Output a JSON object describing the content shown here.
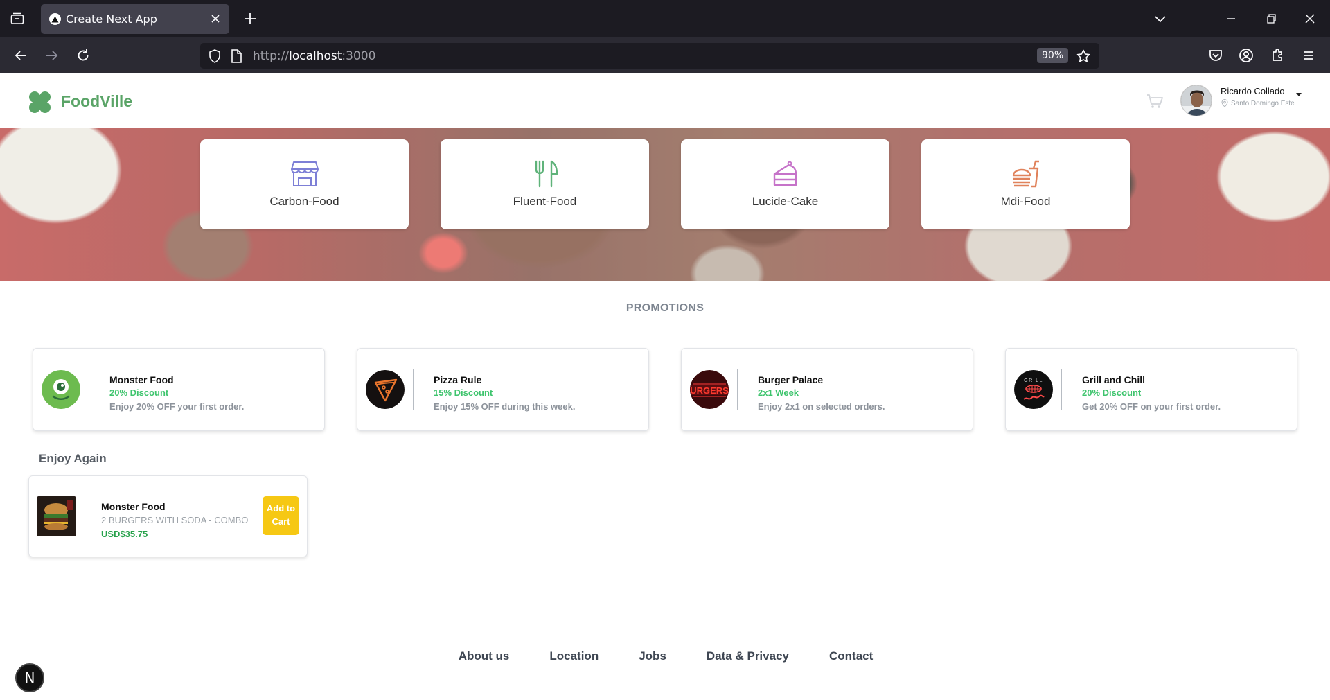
{
  "browser": {
    "tab_title": "Create Next App",
    "url_scheme": "http://",
    "url_host": "localhost",
    "url_port": ":3000",
    "zoom": "90%"
  },
  "header": {
    "brand": "FoodVille",
    "user_name": "Ricardo Collado",
    "user_location": "Santo Domingo Este",
    "brand_color": "#5aa467"
  },
  "categories": [
    {
      "label": "Carbon-Food",
      "icon": "storefront-icon",
      "color": "#7d7fd6"
    },
    {
      "label": "Fluent-Food",
      "icon": "fork-knife-icon",
      "color": "#5fb37a"
    },
    {
      "label": "Lucide-Cake",
      "icon": "cake-slice-icon",
      "color": "#c673c9"
    },
    {
      "label": "Mdi-Food",
      "icon": "burger-drink-icon",
      "color": "#e0825b"
    }
  ],
  "promotions": {
    "title": "PROMOTIONS",
    "items": [
      {
        "name": "Monster Food",
        "discount": "20% Discount",
        "desc": "Enjoy 20% OFF your first order."
      },
      {
        "name": "Pizza Rule",
        "discount": "15% Discount",
        "desc": "Enjoy 15% OFF during this week."
      },
      {
        "name": "Burger Palace",
        "discount": "2x1 Week",
        "desc": "Enjoy 2x1 on selected orders."
      },
      {
        "name": "Grill and Chill",
        "discount": "20% Discount",
        "desc": "Get 20% OFF on your first order."
      }
    ]
  },
  "enjoy_again": {
    "title": "Enjoy Again",
    "item": {
      "name": "Monster Food",
      "desc": "2 BURGERS WITH SODA - COMBO",
      "price": "USD$35.75",
      "button": "Add to Cart"
    }
  },
  "footer": {
    "links": [
      "About us",
      "Location",
      "Jobs",
      "Data & Privacy",
      "Contact"
    ]
  },
  "next_badge": "N",
  "promo_logo_texts": {
    "burger": "URGERS",
    "grill": "GRILL"
  }
}
